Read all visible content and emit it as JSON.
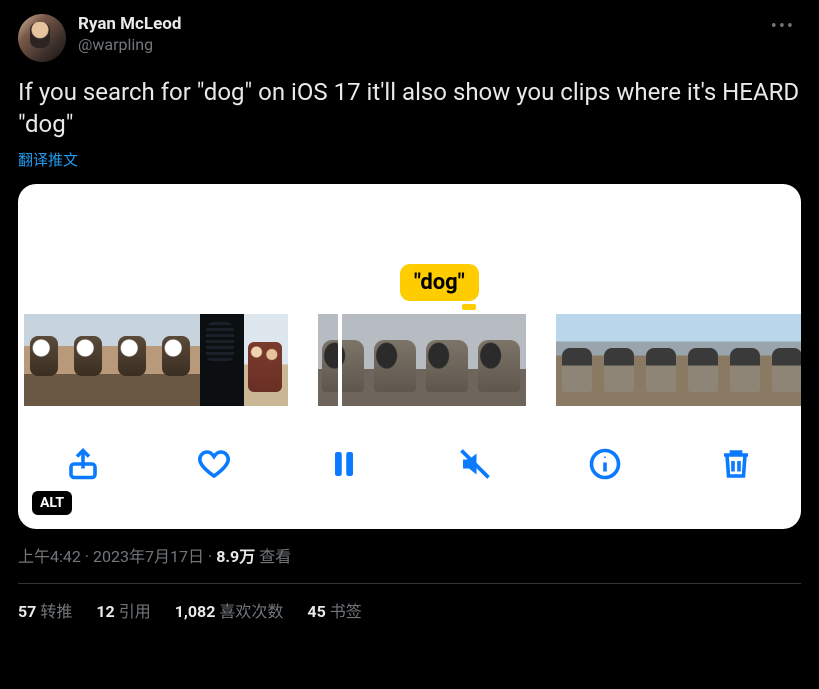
{
  "author": {
    "display_name": "Ryan McLeod",
    "handle": "@warpling"
  },
  "tweet_text": "If you search for \"dog\" on iOS 17 it'll also show you clips where it's HEARD \"dog\"",
  "translate_label": "翻译推文",
  "media": {
    "tooltip": "\"dog\"",
    "alt_badge": "ALT",
    "toolbar": {
      "share": "share",
      "like": "like",
      "pause": "pause",
      "mute": "mute",
      "info": "info",
      "trash": "trash"
    }
  },
  "meta": {
    "time": "上午4:42",
    "sep1": " · ",
    "date": "2023年7月17日",
    "sep2": " · ",
    "views_n": "8.9万",
    "views_label": " 查看"
  },
  "stats": {
    "retweets_n": "57",
    "retweets_label": "转推",
    "quotes_n": "12",
    "quotes_label": "引用",
    "likes_n": "1,082",
    "likes_label": "喜欢次数",
    "bookmarks_n": "45",
    "bookmarks_label": "书签"
  }
}
